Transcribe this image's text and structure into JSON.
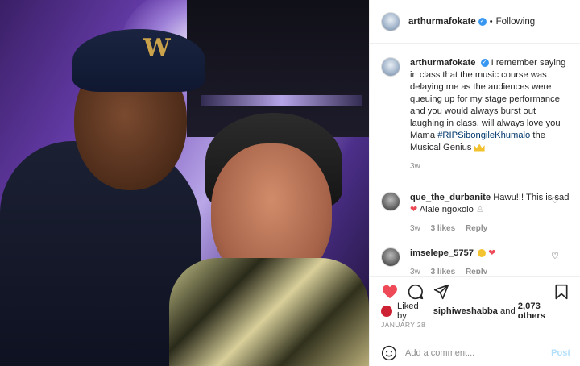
{
  "post": {
    "username": "arthurmafokate",
    "follow_status": "Following",
    "caption_user": "arthurmafokate",
    "caption_text": "I remember saying in class that the music course was delaying me as the audiences were queuing up for my stage performance and you would always burst out laughing in class, will always love you Mama",
    "caption_hashtag": "#RIPSibongileKhumalo",
    "caption_tail": "the Musical Genius",
    "caption_age": "3w"
  },
  "comments": [
    {
      "user": "que_the_durbanite",
      "text_a": "Hawu!!! This is sad",
      "text_b": "Alale ngoxolo",
      "age": "3w",
      "likes": "3 likes",
      "reply": "Reply"
    },
    {
      "user": "imselepe_5757",
      "age": "3w",
      "likes": "3 likes",
      "reply": "Reply"
    }
  ],
  "likes": {
    "prefix": "Liked by",
    "user": "siphiweshabba",
    "mid": "and",
    "count": "2,073 others"
  },
  "date": "JANUARY 28",
  "add_comment": {
    "placeholder": "Add a comment...",
    "post_label": "Post"
  },
  "colors": {
    "like_red": "#ed4956",
    "verified_blue": "#3897f0",
    "hashtag": "#00376b",
    "post_disabled": "#b2dffc"
  }
}
